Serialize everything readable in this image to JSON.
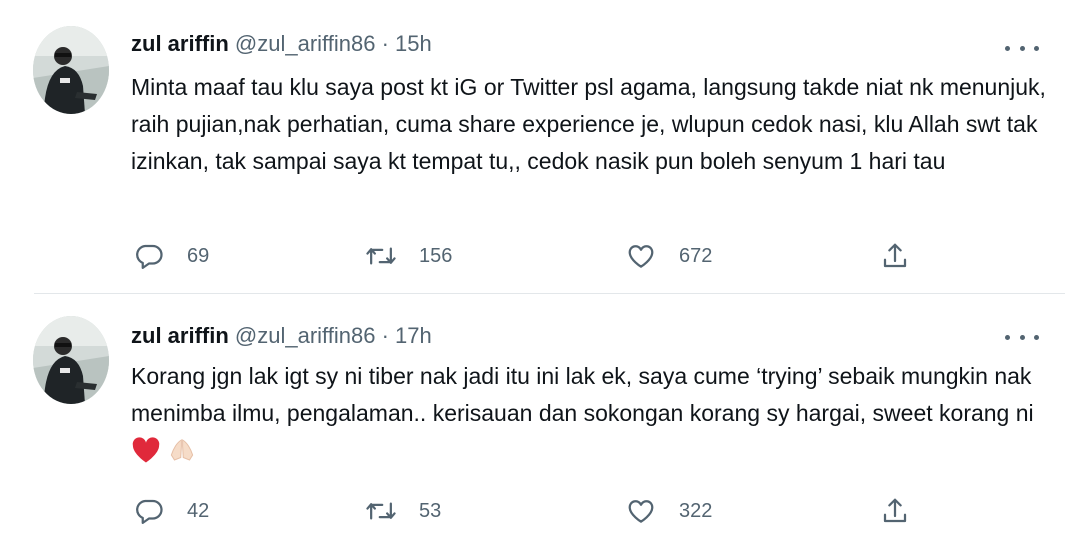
{
  "tweets": [
    {
      "name": "zul ariffin",
      "handle": "@zul_ariffin86",
      "separator": "·",
      "time": "15h",
      "text": "Minta maaf tau klu saya post kt iG or Twitter psl agama, langsung takde niat nk menunjuk, raih pujian,nak perhatian, cuma share experience je, wlupun cedok nasi, klu Allah swt tak izinkan, tak sampai saya kt tempat tu,, cedok nasik pun boleh senyum 1 hari tau",
      "replies": "69",
      "retweets": "156",
      "likes": "672"
    },
    {
      "name": "zul ariffin",
      "handle": "@zul_ariffin86",
      "separator": "·",
      "time": "17h",
      "text": "Korang jgn lak igt sy ni tiber nak jadi itu ini lak ek, saya cume ‘trying’ sebaik mungkin nak menimba ilmu, pengalaman.. kerisauan dan sokongan korang sy hargai, sweet korang ni",
      "emoji": [
        "red-heart",
        "folded-hands"
      ],
      "replies": "42",
      "retweets": "53",
      "likes": "322"
    }
  ],
  "icons": {
    "reply": "reply-icon",
    "retweet": "retweet-icon",
    "like": "like-icon",
    "share": "share-icon",
    "more": "more-icon"
  },
  "colors": {
    "text": "#0f1419",
    "secondary": "#536471",
    "divider": "#e3e7ea",
    "heart": "#e0293b"
  }
}
